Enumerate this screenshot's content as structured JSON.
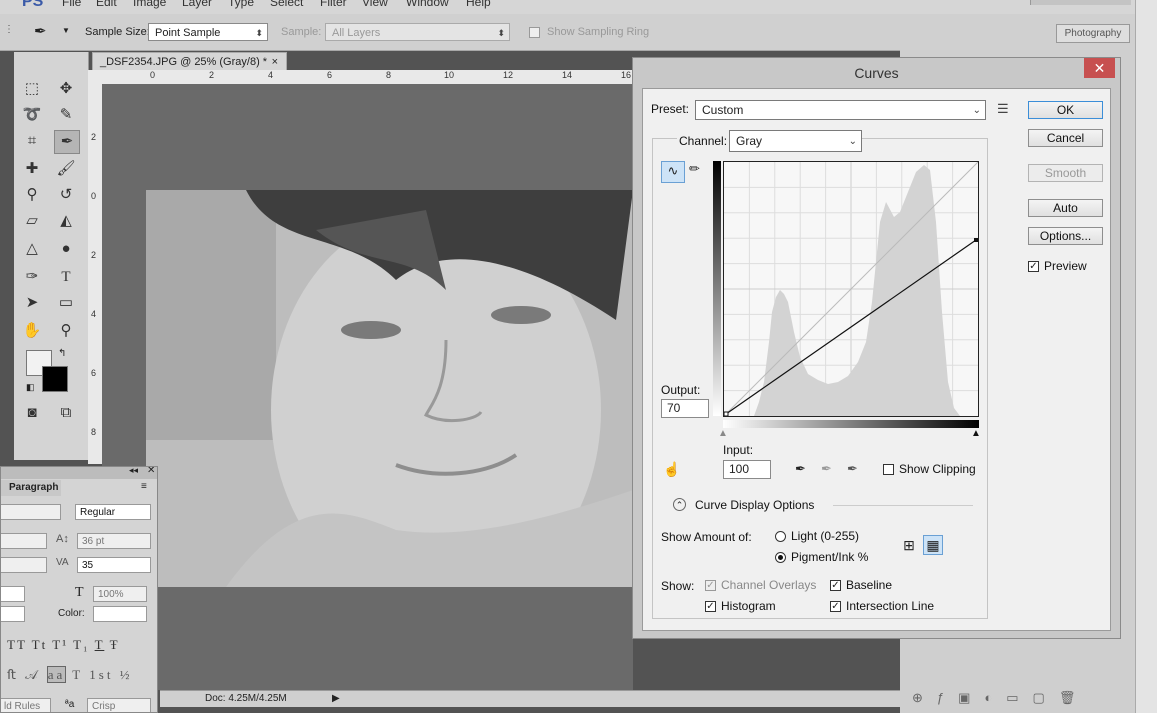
{
  "app": {
    "logo": "PS",
    "menu": [
      "File",
      "Edit",
      "Image",
      "Layer",
      "Type",
      "Select",
      "Filter",
      "View",
      "Window",
      "Help"
    ]
  },
  "options_bar": {
    "sample_size_label": "Sample Size:",
    "sample_size_value": "Point Sample",
    "sample_label": "Sample:",
    "sample_value": "All Layers",
    "show_ring_label": "Show Sampling Ring",
    "workspace": "Photography"
  },
  "document": {
    "tab_title": "_DSF2354.JPG @ 25% (Gray/8) *",
    "close": "×",
    "ruler_h": [
      "0",
      "2",
      "4",
      "6",
      "8",
      "10",
      "12",
      "14",
      "16"
    ],
    "ruler_v": [
      "2",
      "0",
      "2",
      "4",
      "6",
      "8"
    ],
    "status": "Doc: 4.25M/4.25M"
  },
  "character_panel": {
    "tab": "Paragraph",
    "font_style": "Regular",
    "leading": "36 pt",
    "tracking": "35",
    "scale": "100%",
    "color_label": "Color:",
    "glyph_buttons": [
      "TT",
      "Tt",
      "T¹",
      "T₁",
      "T",
      "Ŧ"
    ],
    "glyph_buttons2": [
      "ﬅ",
      "𝒜",
      "aa",
      "T",
      "1st",
      "½"
    ],
    "bottom_left": "ld Rules",
    "bottom_aa": "ªa",
    "bottom_crisp": "Crisp"
  },
  "curves": {
    "title": "Curves",
    "preset_label": "Preset:",
    "preset_value": "Custom",
    "channel_label": "Channel:",
    "channel_value": "Gray",
    "output_label": "Output:",
    "output_value": "70",
    "input_label": "Input:",
    "input_value": "100",
    "show_clipping": "Show Clipping",
    "display_options": "Curve Display Options",
    "show_amount_label": "Show Amount of:",
    "light_label": "Light  (0-255)",
    "pigment_label": "Pigment/Ink %",
    "show_label": "Show:",
    "channel_overlays": "Channel Overlays",
    "baseline": "Baseline",
    "histogram": "Histogram",
    "intersection_line": "Intersection Line",
    "buttons": {
      "ok": "OK",
      "cancel": "Cancel",
      "smooth": "Smooth",
      "auto": "Auto",
      "options": "Options..."
    },
    "preview_label": "Preview",
    "curve_point": {
      "input": 100,
      "output": 70
    }
  }
}
